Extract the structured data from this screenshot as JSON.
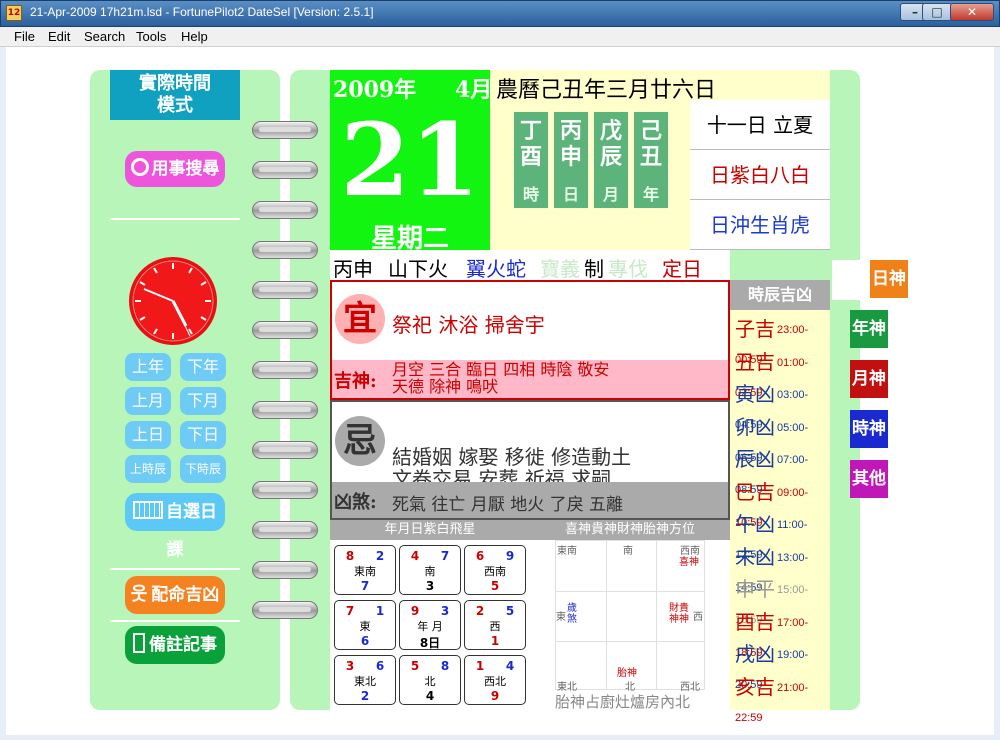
{
  "window": {
    "title": "21-Apr-2009 17h21m.lsd - FortunePilot2 DateSel [Version: 2.5.1]",
    "icon_label": "12",
    "min": "–",
    "max": "□",
    "close": "✕"
  },
  "menu": [
    "File",
    "Edit",
    "Search",
    "Tools",
    "Help"
  ],
  "left": {
    "mode": "實際時間模式",
    "mode_line1": "實際時間",
    "mode_line2": "模式",
    "search_btn": "用事搜尋",
    "nav": [
      [
        "上年",
        "下年"
      ],
      [
        "上月",
        "下月"
      ],
      [
        "上日",
        "下日"
      ],
      [
        "上時辰",
        "下時辰"
      ]
    ],
    "select_btn": "自選日課",
    "match_btn": "配命吉凶",
    "notes_btn": "備註記事"
  },
  "date": {
    "year": "2009年",
    "month": "4月",
    "day": "21",
    "weekday": "星期二",
    "lunar": "農曆己丑年三月廿六日"
  },
  "pillars": [
    {
      "g": "丁",
      "b": "酉",
      "lbl": "時"
    },
    {
      "g": "丙",
      "b": "申",
      "lbl": "日"
    },
    {
      "g": "戊",
      "b": "辰",
      "lbl": "月"
    },
    {
      "g": "己",
      "b": "丑",
      "lbl": "年"
    }
  ],
  "info": {
    "solar_term": "十一日 立夏",
    "star": "日紫白八白",
    "clash": "日沖生肖虎"
  },
  "strip": {
    "ganzhi": "丙申",
    "nayin": "山下火",
    "mansion": "翼火蛇",
    "faded1": "寶義",
    "zhi": "制",
    "faded2": "專伐",
    "officer": "定日"
  },
  "yi": {
    "char": "宜",
    "items": "祭祀  沐浴  掃舍宇"
  },
  "jishen": {
    "label": "吉神:",
    "line1": "月空  三合  臨日  四相  時陰  敬安",
    "line2": "天德  除神  鳴吠"
  },
  "ji": {
    "char": "忌",
    "line1": "結婚姻  嫁娶  移徙  修造動土",
    "line2": "文卷交易  安葬  祈福  求嗣"
  },
  "xiongsha": {
    "label": "凶煞:",
    "items": "死氣  往亡  月厭  地火  了戾  五離"
  },
  "hours": {
    "header": "時辰吉凶",
    "rows": [
      {
        "name": "子吉",
        "time": "23:00-00:59",
        "color": "#cc0000"
      },
      {
        "name": "丑吉",
        "time": "01:00-02:59",
        "color": "#cc0000"
      },
      {
        "name": "寅凶",
        "time": "03:00-04:59",
        "color": "#1a3aa0"
      },
      {
        "name": "卯凶",
        "time": "05:00-06:59",
        "color": "#1a3aa0"
      },
      {
        "name": "辰凶",
        "time": "07:00-08:59",
        "color": "#1a3aa0"
      },
      {
        "name": "巳吉",
        "time": "09:00-10:59",
        "color": "#cc0000"
      },
      {
        "name": "午凶",
        "time": "11:00-12:59",
        "color": "#1a3aa0"
      },
      {
        "name": "未凶",
        "time": "13:00-14:59",
        "color": "#1a3aa0"
      },
      {
        "name": "申平",
        "time": "15:00-16:59",
        "color": "#999999"
      },
      {
        "name": "酉吉",
        "time": "17:00-18:59",
        "color": "#cc0000"
      },
      {
        "name": "戌凶",
        "time": "19:00-20:59",
        "color": "#1a3aa0"
      },
      {
        "name": "亥吉",
        "time": "21:00-22:59",
        "color": "#cc0000"
      }
    ]
  },
  "tabs": [
    {
      "label": "日神",
      "color": "#f08018"
    },
    {
      "label": "年神",
      "color": "#1a9a40"
    },
    {
      "label": "月神",
      "color": "#c01010"
    },
    {
      "label": "時神",
      "color": "#1a2ad0"
    },
    {
      "label": "其他",
      "color": "#c018b8"
    }
  ],
  "flying_star": {
    "header": "年月日紫白飛星",
    "cells": [
      {
        "a": "8",
        "b": "2",
        "dir": "東南",
        "c": "7"
      },
      {
        "a": "4",
        "b": "7",
        "dir": "南",
        "c": "3"
      },
      {
        "a": "6",
        "b": "9",
        "dir": "西南",
        "c": "5"
      },
      {
        "a": "7",
        "b": "1",
        "dir": "東",
        "c": "6"
      },
      {
        "a": "9",
        "b": "3",
        "dir": "年    月",
        "c": "8日"
      },
      {
        "a": "2",
        "b": "5",
        "dir": "西",
        "c": "1"
      },
      {
        "a": "3",
        "b": "6",
        "dir": "東北",
        "c": "2"
      },
      {
        "a": "5",
        "b": "8",
        "dir": "北",
        "c": "4"
      },
      {
        "a": "1",
        "b": "4",
        "dir": "西北",
        "c": "9"
      }
    ]
  },
  "direction": {
    "header": "喜神貴神財神胎神方位",
    "dirs": {
      "se": "東南",
      "s": "南",
      "sw": "西南",
      "e": "東",
      "w": "西",
      "ne": "東北",
      "n": "北",
      "nw": "西北"
    },
    "suisha": "歲煞",
    "xishen": "喜神",
    "caigui": "財貴",
    "shenshen": "神神",
    "taishen": "胎神",
    "footer": "胎神占廚灶爐房內北"
  }
}
